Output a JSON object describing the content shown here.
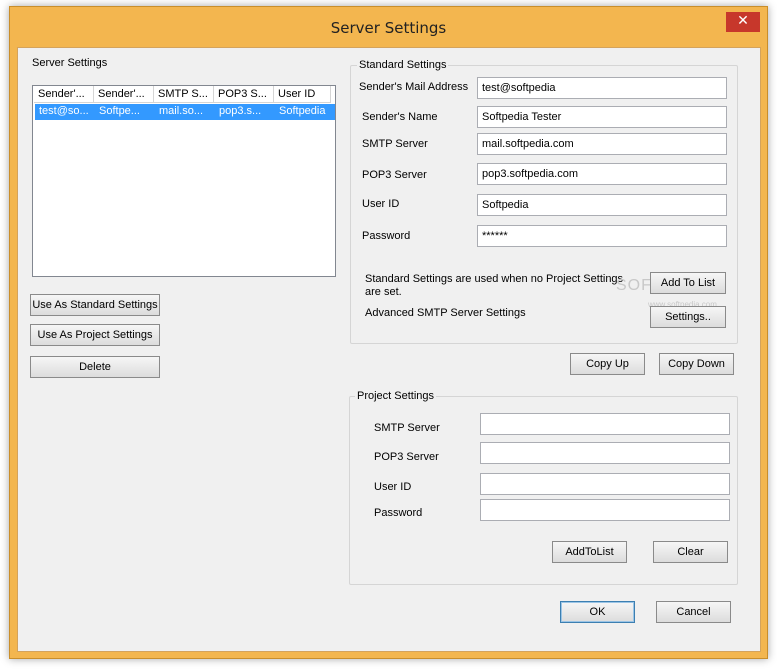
{
  "window": {
    "title": "Server Settings",
    "close_glyph": "✕"
  },
  "server_settings": {
    "label": "Server Settings",
    "columns": [
      "Sender'...",
      "Sender'...",
      "SMTP S...",
      "POP3 S...",
      "User ID"
    ],
    "rows": [
      {
        "cells": [
          "test@so...",
          "Softpe...",
          "mail.so...",
          "pop3.s...",
          "Softpedia"
        ],
        "selected": true
      }
    ]
  },
  "left_buttons": {
    "use_standard": "Use As Standard Settings",
    "use_project": "Use As Project Settings",
    "delete": "Delete"
  },
  "standard": {
    "title": "Standard Settings",
    "fields": [
      {
        "label": "Sender's Mail Address",
        "value": "test@softpedia"
      },
      {
        "label": "Sender's Name",
        "value": "Softpedia Tester"
      },
      {
        "label": "SMTP Server",
        "value": "mail.softpedia.com"
      },
      {
        "label": "POP3 Server",
        "value": "pop3.softpedia.com"
      },
      {
        "label": "User ID",
        "value": "Softpedia"
      },
      {
        "label": "Password",
        "value": "******"
      }
    ],
    "note_line1": "Standard Settings are used when no Project Settings",
    "note_line2": "are set.",
    "add_to_list": "Add To List",
    "advanced_label": "Advanced SMTP Server Settings",
    "settings_button": "Settings.."
  },
  "copy": {
    "up": "Copy Up",
    "down": "Copy Down"
  },
  "project": {
    "title": "Project Settings",
    "fields": [
      {
        "label": "SMTP Server",
        "value": ""
      },
      {
        "label": "POP3 Server",
        "value": ""
      },
      {
        "label": "User ID",
        "value": ""
      },
      {
        "label": "Password",
        "value": ""
      }
    ],
    "add_to_list": "AddToList",
    "clear": "Clear"
  },
  "footer": {
    "ok": "OK",
    "cancel": "Cancel"
  },
  "watermark": {
    "text": "SOFTPEDIA",
    "sub": "www.softpedia.com"
  },
  "colors": {
    "title_bar": "#f3b64f",
    "close": "#c7372b",
    "selection": "#3399ff",
    "client": "#f0f0f0"
  }
}
